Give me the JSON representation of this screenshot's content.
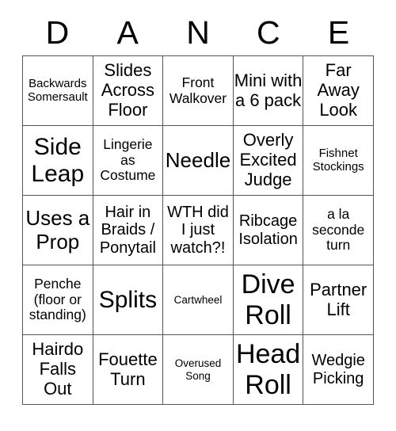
{
  "card": {
    "title_letters": [
      "D",
      "A",
      "N",
      "C",
      "E"
    ],
    "columns": 5,
    "rows": 5,
    "border_color": "#555555",
    "text_color": "#000000",
    "background_color": "#ffffff",
    "cells": [
      [
        {
          "text": "Backwards Somersault",
          "size": "fs-s"
        },
        {
          "text": "Slides Across Floor",
          "size": "fs-xl"
        },
        {
          "text": "Front Walkover",
          "size": "fs-m"
        },
        {
          "text": "Mini with a 6 pack",
          "size": "fs-xl"
        },
        {
          "text": "Far Away Look",
          "size": "fs-xl"
        }
      ],
      [
        {
          "text": "Side Leap",
          "size": "fs-3xl"
        },
        {
          "text": "Lingerie as Costume",
          "size": "fs-m"
        },
        {
          "text": "Needle",
          "size": "fs-2xl"
        },
        {
          "text": "Overly Excited Judge",
          "size": "fs-xl"
        },
        {
          "text": "Fishnet Stockings",
          "size": "fs-s"
        }
      ],
      [
        {
          "text": "Uses a Prop",
          "size": "fs-2xl"
        },
        {
          "text": "Hair in Braids / Ponytail",
          "size": "fs-l"
        },
        {
          "text": "WTH did I just watch?!",
          "size": "fs-l"
        },
        {
          "text": "Ribcage Isolation",
          "size": "fs-l"
        },
        {
          "text": "a la seconde turn",
          "size": "fs-m"
        }
      ],
      [
        {
          "text": "Penche (floor or standing)",
          "size": "fs-m"
        },
        {
          "text": "Splits",
          "size": "fs-3xl"
        },
        {
          "text": "Cartwheel",
          "size": "fs-xs"
        },
        {
          "text": "Dive Roll",
          "size": "fs-4xl"
        },
        {
          "text": "Partner Lift",
          "size": "fs-xl"
        }
      ],
      [
        {
          "text": "Hairdo Falls Out",
          "size": "fs-xl"
        },
        {
          "text": "Fouette Turn",
          "size": "fs-xl"
        },
        {
          "text": "Overused Song",
          "size": "fs-xs"
        },
        {
          "text": "Head Roll",
          "size": "fs-4xl"
        },
        {
          "text": "Wedgie Picking",
          "size": "fs-l"
        }
      ]
    ]
  }
}
